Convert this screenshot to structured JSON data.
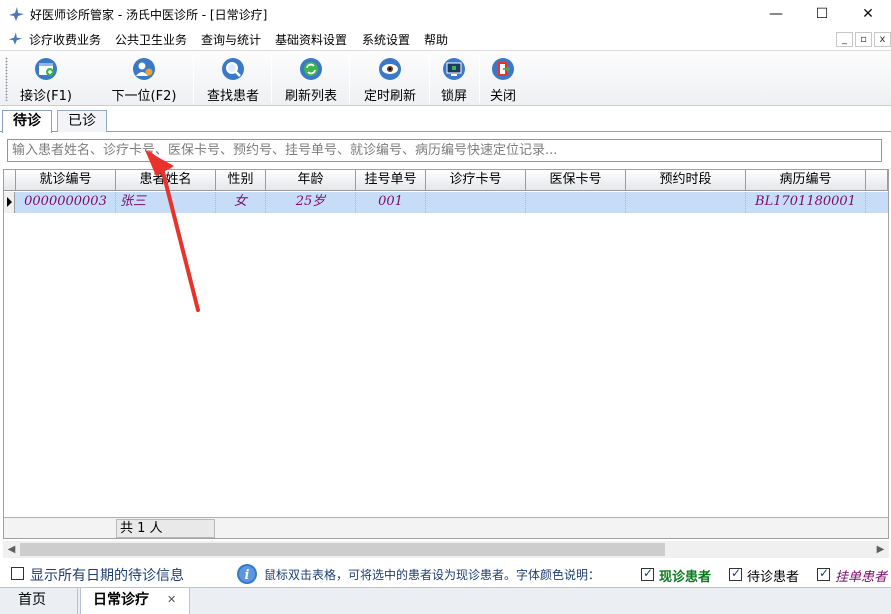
{
  "window": {
    "title": "好医师诊所管家 - 汤氏中医诊所 - [日常诊疗]",
    "controls": {
      "minimize": "—",
      "maximize": "☐",
      "close": "✕"
    }
  },
  "menu": {
    "items": [
      "诊疗收费业务",
      "公共卫生业务",
      "查询与统计",
      "基础资料设置",
      "系统设置",
      "帮助"
    ],
    "mdi_controls": [
      "_",
      "▫",
      "x"
    ]
  },
  "toolbar": {
    "buttons": [
      {
        "label": "接诊(F1)",
        "icon": "receive-patient-icon"
      },
      {
        "label": "下一位(F2)",
        "icon": "next-patient-icon"
      },
      {
        "label": "查找患者",
        "icon": "search-icon"
      },
      {
        "label": "刷新列表",
        "icon": "refresh-icon"
      },
      {
        "label": "定时刷新",
        "icon": "eye-icon"
      },
      {
        "label": "锁屏",
        "icon": "monitor-lock-icon"
      },
      {
        "label": "关闭",
        "icon": "exit-icon"
      }
    ]
  },
  "tabs": [
    "待诊",
    "已诊"
  ],
  "search": {
    "placeholder": "输入患者姓名、诊疗卡号、医保卡号、预约号、挂号单号、就诊编号、病历编号快速定位记录..."
  },
  "grid": {
    "columns": [
      "就诊编号",
      "患者姓名",
      "性别",
      "年龄",
      "挂号单号",
      "诊疗卡号",
      "医保卡号",
      "预约时段",
      "病历编号"
    ],
    "rows": [
      [
        "0000000003",
        "张三",
        "女",
        "25岁",
        "001",
        "",
        "",
        "",
        "BL1701180001"
      ]
    ],
    "footer_count": "共 1 人"
  },
  "statusbar": {
    "show_all_label": "显示所有日期的待诊信息",
    "show_all_checked": false,
    "hint": "鼠标双击表格，可将选中的患者设为现诊患者。字体颜色说明：",
    "legend": [
      {
        "label": "现诊患者",
        "color": "#0a7a1e",
        "checked": true
      },
      {
        "label": "待诊患者",
        "color": "#000000",
        "checked": true
      },
      {
        "label": "挂单患者",
        "color": "#7a0c6b",
        "checked": true
      }
    ]
  },
  "doc_tabs": [
    {
      "label": "首页",
      "active": false
    },
    {
      "label": "日常诊疗",
      "active": true,
      "close": "✕"
    }
  ],
  "colors": {
    "selected_row": "#c7ddf7",
    "row_text": "#7a0c6b",
    "annotation": "#e8322a"
  }
}
